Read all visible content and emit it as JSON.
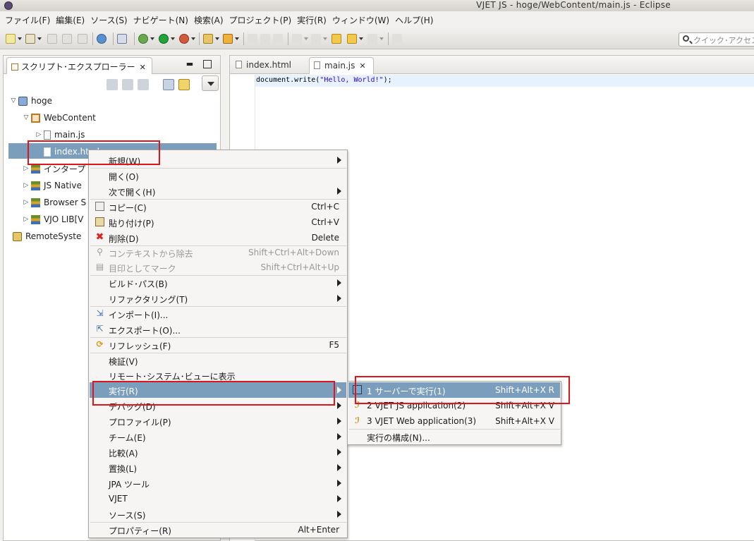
{
  "window": {
    "title": "VJET JS - hoge/WebContent/main.js - Eclipse"
  },
  "menubar": [
    "ファイル(F)",
    "編集(E)",
    "ソース(S)",
    "ナビゲート(N)",
    "検索(A)",
    "プロジェクト(P)",
    "実行(R)",
    "ウィンドウ(W)",
    "ヘルプ(H)"
  ],
  "toolbar": {
    "quick_access_placeholder": "クイック･アクセス"
  },
  "explorer": {
    "tab_label": "スクリプト･エクスプローラー",
    "tree": [
      {
        "label": "hoge",
        "indent": 0,
        "twisty": "open"
      },
      {
        "label": "WebContent",
        "indent": 1,
        "twisty": "open"
      },
      {
        "label": "main.js",
        "indent": 2,
        "twisty": "closed"
      },
      {
        "label": "index.html",
        "indent": 2,
        "twisty": "none",
        "selected": true
      },
      {
        "label": "インタープ",
        "indent": 1,
        "twisty": "closed"
      },
      {
        "label": "JS Native",
        "indent": 1,
        "twisty": "closed"
      },
      {
        "label": "Browser S",
        "indent": 1,
        "twisty": "closed"
      },
      {
        "label": "VJO LIB[V",
        "indent": 1,
        "twisty": "closed"
      },
      {
        "label": "RemoteSyste",
        "indent": 0,
        "twisty": "none"
      }
    ]
  },
  "editor": {
    "tabs": [
      {
        "label": "index.html",
        "active": false
      },
      {
        "label": "main.js",
        "active": true
      }
    ],
    "code": {
      "pre": "document.write(",
      "str": "\"Hello, World!\"",
      "post": ");"
    }
  },
  "context_menu": {
    "items": [
      {
        "label": "新規(W)",
        "shortcut": "",
        "submenu": true,
        "icon": ""
      },
      {
        "label": "開く(O)",
        "shortcut": "",
        "submenu": false,
        "icon": ""
      },
      {
        "label": "次で開く(H)",
        "shortcut": "",
        "submenu": true,
        "icon": ""
      },
      {
        "label": "コピー(C)",
        "shortcut": "Ctrl+C",
        "submenu": false,
        "icon": "copy-icon"
      },
      {
        "label": "貼り付け(P)",
        "shortcut": "Ctrl+V",
        "submenu": false,
        "icon": "paste-icon"
      },
      {
        "label": "削除(D)",
        "shortcut": "Delete",
        "submenu": false,
        "icon": "delete-icon"
      },
      {
        "label": "コンテキストから除去",
        "shortcut": "Shift+Ctrl+Alt+Down",
        "submenu": false,
        "icon": "remove-context-icon",
        "disabled": true
      },
      {
        "label": "目印としてマーク",
        "shortcut": "Shift+Ctrl+Alt+Up",
        "submenu": false,
        "icon": "mark-landmark-icon",
        "disabled": true
      },
      {
        "label": "ビルド･パス(B)",
        "shortcut": "",
        "submenu": true,
        "icon": ""
      },
      {
        "label": "リファクタリング(T)",
        "shortcut": "",
        "submenu": true,
        "icon": ""
      },
      {
        "label": "インポート(I)...",
        "shortcut": "",
        "submenu": false,
        "icon": "import-icon"
      },
      {
        "label": "エクスポート(O)...",
        "shortcut": "",
        "submenu": false,
        "icon": "export-icon"
      },
      {
        "label": "リフレッシュ(F)",
        "shortcut": "F5",
        "submenu": false,
        "icon": "refresh-icon"
      },
      {
        "label": "検証(V)",
        "shortcut": "",
        "submenu": false,
        "icon": ""
      },
      {
        "label": "リモート･システム･ビューに表示",
        "shortcut": "",
        "submenu": false,
        "icon": ""
      },
      {
        "label": "実行(R)",
        "shortcut": "",
        "submenu": true,
        "icon": "",
        "highlighted": true
      },
      {
        "label": "デバッグ(D)",
        "shortcut": "",
        "submenu": true,
        "icon": ""
      },
      {
        "label": "プロファイル(P)",
        "shortcut": "",
        "submenu": true,
        "icon": ""
      },
      {
        "label": "チーム(E)",
        "shortcut": "",
        "submenu": true,
        "icon": ""
      },
      {
        "label": "比較(A)",
        "shortcut": "",
        "submenu": true,
        "icon": ""
      },
      {
        "label": "置換(L)",
        "shortcut": "",
        "submenu": true,
        "icon": ""
      },
      {
        "label": "JPA ツール",
        "shortcut": "",
        "submenu": true,
        "icon": ""
      },
      {
        "label": "VJET",
        "shortcut": "",
        "submenu": true,
        "icon": ""
      },
      {
        "label": "ソース(S)",
        "shortcut": "",
        "submenu": true,
        "icon": ""
      },
      {
        "label": "プロパティー(R)",
        "shortcut": "Alt+Enter",
        "submenu": false,
        "icon": ""
      }
    ]
  },
  "run_submenu": {
    "items": [
      {
        "label": "1 サーバーで実行(1)",
        "shortcut": "Shift+Alt+X R",
        "highlighted": true,
        "icon": "server-run-icon"
      },
      {
        "label": "2 VJET JS application(2)",
        "shortcut": "Shift+Alt+X V",
        "icon": "vjet-js-icon"
      },
      {
        "label": "3 VJET Web application(3)",
        "shortcut": "Shift+Alt+X V",
        "icon": "vjet-web-icon"
      },
      {
        "label": "実行の構成(N)...",
        "shortcut": "",
        "icon": ""
      }
    ]
  },
  "colors": {
    "selection": "#7b9ebd",
    "annotation_red": "#e0151c",
    "string_literal": "#2a00ff"
  }
}
